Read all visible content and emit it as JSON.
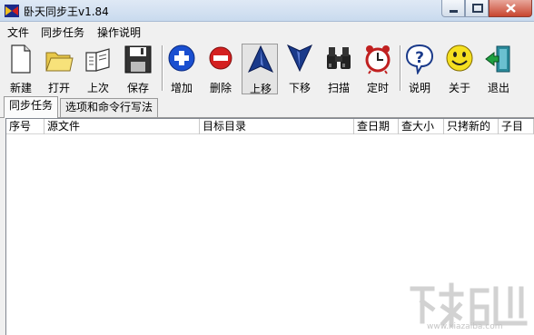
{
  "window": {
    "title": "卧天同步王v1.84"
  },
  "menu": [
    "文件",
    "同步任务",
    "操作说明"
  ],
  "toolbar": {
    "new": "新建",
    "open": "打开",
    "last": "上次",
    "save": "保存",
    "add": "增加",
    "delete": "删除",
    "move_up": "上移",
    "move_down": "下移",
    "scan": "扫描",
    "timer": "定时",
    "help": "说明",
    "about": "关于",
    "exit": "退出"
  },
  "tabs": [
    "同步任务",
    "选项和命令行写法"
  ],
  "columns": [
    "序号",
    "源文件",
    "目标目录",
    "查日期",
    "查大小",
    "只拷新的",
    "子目"
  ],
  "watermark": {
    "url": "www.xiazaiba.com"
  },
  "colors": {
    "title_gradient_top": "#dfe9f5",
    "close_red": "#c8452f",
    "add_blue": "#1a4fd0",
    "delete_red": "#d42020"
  }
}
